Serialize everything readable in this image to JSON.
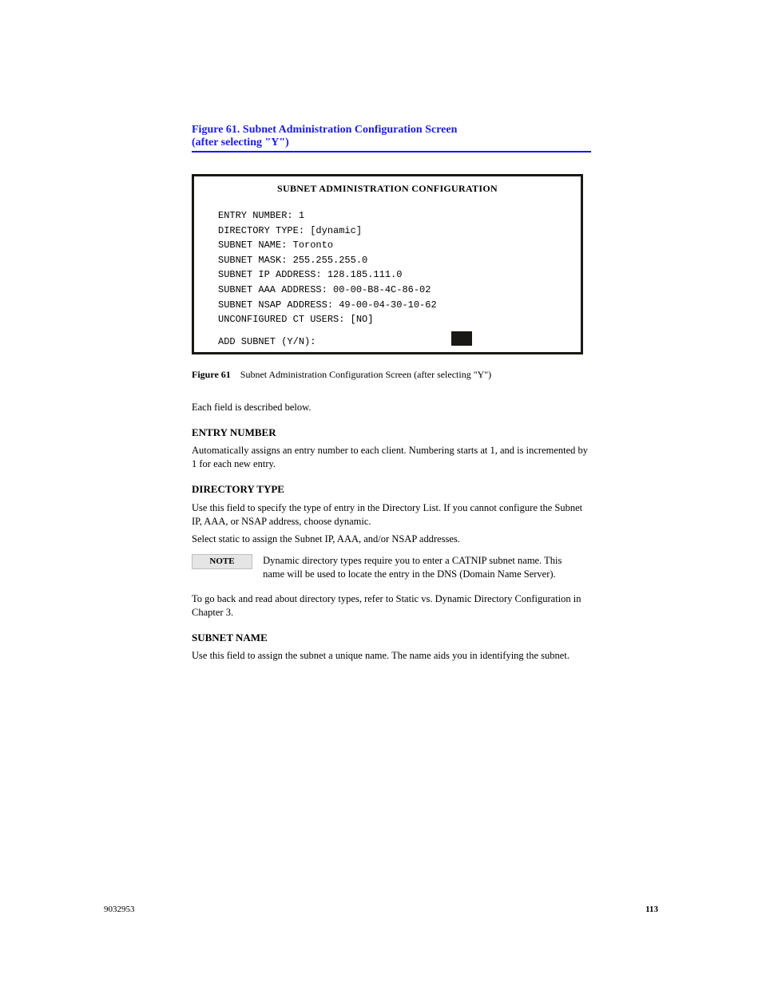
{
  "title": {
    "line1": "Figure 61. Subnet Administration Configuration Screen",
    "line2": "(after selecting \"Y\")"
  },
  "panel": {
    "header": "SUBNET ADMINISTRATION CONFIGURATION",
    "lines": [
      "ENTRY  NUMBER: 1",
      "DIRECTORY  TYPE: [dynamic]",
      "SUBNET  NAME: Toronto",
      "SUBNET  MASK: 255.255.255.0",
      "SUBNET  IP ADDRESS: 128.185.111.0",
      "SUBNET  AAA ADDRESS: 00-00-B8-4C-86-02",
      "SUBNET  NSAP ADDRESS: 49-00-04-30-10-62",
      "UNCONFIGURED  CT USERS: [NO]"
    ],
    "addLabel": "ADD SUBNET (Y/N):"
  },
  "figure": {
    "label": "Figure 61",
    "text": "Subnet Administration Configuration Screen (after selecting \"Y\")"
  },
  "body": {
    "line1": "Each field is described below.",
    "entryNumber": {
      "head": "ENTRY NUMBER",
      "para": "Automatically assigns an entry number to each client. Numbering starts at 1, and is incremented by 1 for each new entry."
    },
    "directoryType": {
      "head": "DIRECTORY TYPE",
      "para1": "Use this field to specify the type of entry in the Directory List. If you cannot configure the Subnet IP, AAA, or NSAP address, choose dynamic.",
      "para2": "Select static to assign the Subnet IP, AAA, and/or NSAP addresses.",
      "note": "Dynamic directory types require you to enter a CATNIP subnet name. This name will be used to locate the entry in the DNS (Domain Name Server).",
      "back": "To go back and read about directory types, refer to Static vs. Dynamic Directory Configuration in Chapter 3."
    },
    "subnetName": {
      "head": "SUBNET NAME",
      "para": "Use this field to assign the subnet a unique name. The name aids you in identifying the subnet."
    },
    "noteLabel": "NOTE"
  },
  "footer": {
    "left": "9032953",
    "right": "113"
  }
}
